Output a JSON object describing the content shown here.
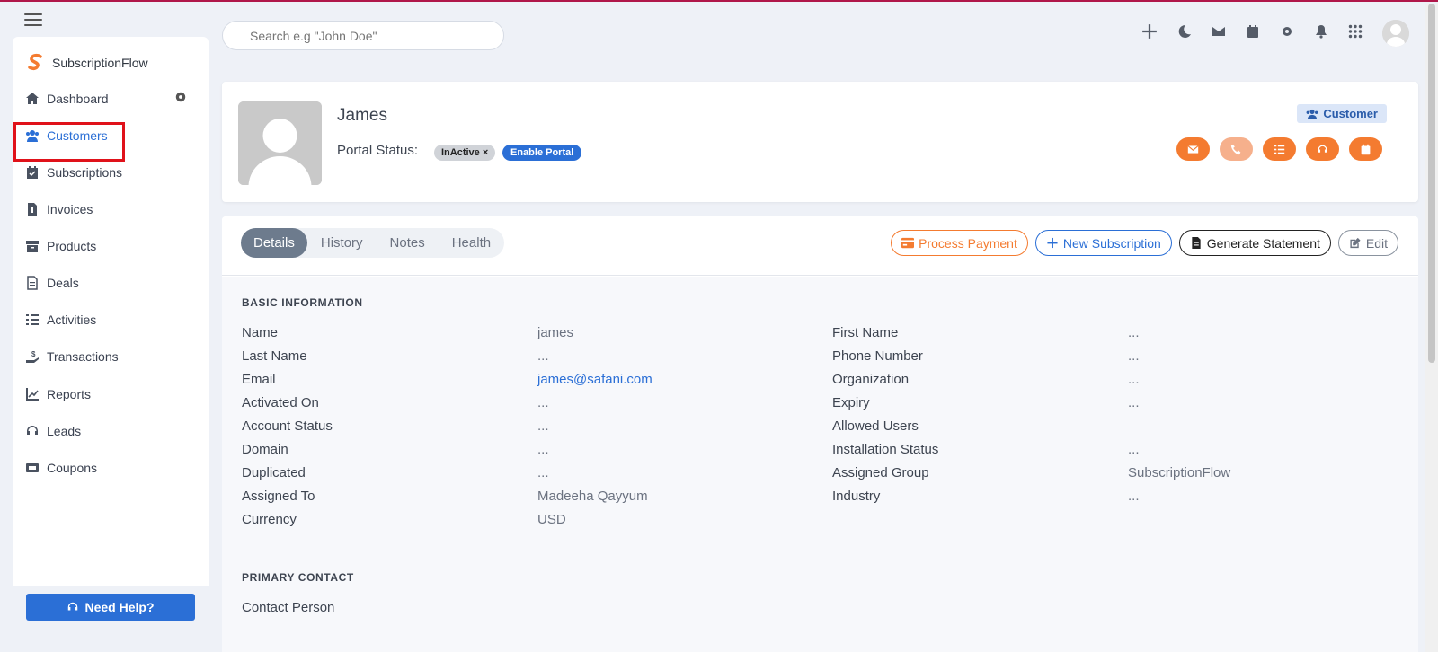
{
  "app": {
    "name": "SubscriptionFlow"
  },
  "search": {
    "placeholder": "Search e.g \"John Doe\""
  },
  "sidebar": {
    "items": [
      {
        "label": "Dashboard",
        "icon": "home-icon"
      },
      {
        "label": "Customers",
        "icon": "users-icon",
        "active": true
      },
      {
        "label": "Subscriptions",
        "icon": "calendar-check-icon"
      },
      {
        "label": "Invoices",
        "icon": "invoice-icon"
      },
      {
        "label": "Products",
        "icon": "archive-icon"
      },
      {
        "label": "Deals",
        "icon": "document-icon"
      },
      {
        "label": "Activities",
        "icon": "tasks-icon"
      },
      {
        "label": "Transactions",
        "icon": "hand-dollar-icon"
      },
      {
        "label": "Reports",
        "icon": "chart-line-icon"
      },
      {
        "label": "Leads",
        "icon": "headset-icon"
      },
      {
        "label": "Coupons",
        "icon": "ticket-icon"
      }
    ],
    "help_label": "Need Help?"
  },
  "profile": {
    "name": "James",
    "portal_status_label": "Portal Status:",
    "status_badge": "InActive ×",
    "enable_portal_label": "Enable Portal",
    "type_tag": "Customer"
  },
  "tabs": [
    "Details",
    "History",
    "Notes",
    "Health"
  ],
  "buttons": {
    "process_payment": "Process Payment",
    "new_subscription": "New Subscription",
    "generate_statement": "Generate Statement",
    "edit": "Edit"
  },
  "basic_information": {
    "title": "BASIC INFORMATION",
    "left": [
      {
        "label": "Name",
        "value": "james"
      },
      {
        "label": "Last Name",
        "value": "..."
      },
      {
        "label": "Email",
        "value": "james@safani.com"
      },
      {
        "label": "Activated On",
        "value": "..."
      },
      {
        "label": "Account Status",
        "value": "..."
      },
      {
        "label": "Domain",
        "value": "..."
      },
      {
        "label": "Duplicated",
        "value": "..."
      },
      {
        "label": "Assigned To",
        "value": "Madeeha Qayyum"
      },
      {
        "label": "Currency",
        "value": "USD"
      }
    ],
    "right": [
      {
        "label": "First Name",
        "value": "..."
      },
      {
        "label": "Phone Number",
        "value": "..."
      },
      {
        "label": "Organization",
        "value": "..."
      },
      {
        "label": "Expiry",
        "value": "..."
      },
      {
        "label": "Allowed Users",
        "value": ""
      },
      {
        "label": "Installation Status",
        "value": "..."
      },
      {
        "label": "Assigned Group",
        "value": "SubscriptionFlow"
      },
      {
        "label": "Industry",
        "value": "..."
      }
    ]
  },
  "primary_contact": {
    "title": "PRIMARY CONTACT",
    "fields": [
      {
        "label": "Contact Person",
        "value": ""
      }
    ]
  },
  "colors": {
    "accent": "#2b6fd6",
    "action": "#f47b30",
    "highlight": "#e0121a"
  }
}
